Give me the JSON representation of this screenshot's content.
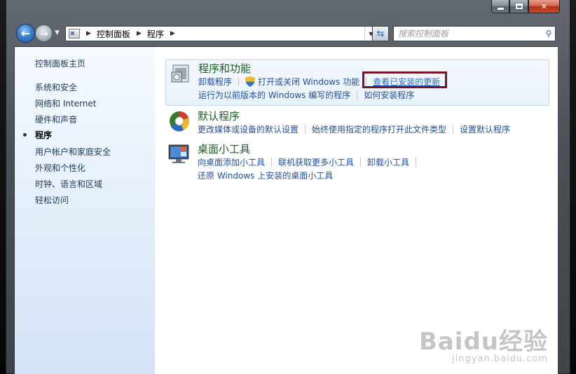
{
  "window": {
    "caption_buttons": {
      "minimize": "minimize",
      "maximize": "maximize",
      "close": "✕"
    }
  },
  "toolbar": {
    "breadcrumb": [
      "控制面板",
      "程序"
    ],
    "search_placeholder": "搜索控制面板"
  },
  "sidebar": {
    "items": [
      {
        "label": "控制面板主页",
        "active": false
      },
      {
        "label": "系统和安全",
        "active": false
      },
      {
        "label": "网络和 Internet",
        "active": false
      },
      {
        "label": "硬件和声音",
        "active": false
      },
      {
        "label": "程序",
        "active": true
      },
      {
        "label": "用户帐户和家庭安全",
        "active": false
      },
      {
        "label": "外观和个性化",
        "active": false
      },
      {
        "label": "时钟、语言和区域",
        "active": false
      },
      {
        "label": "轻松访问",
        "active": false
      }
    ]
  },
  "categories": [
    {
      "title": "程序和功能",
      "icon": "programs-features-icon",
      "rows": [
        [
          "卸载程序",
          "打开或关闭 Windows 功能",
          "查看已安装的更新"
        ],
        [
          "运行为以前版本的 Windows 编写的程序",
          "如何安装程序"
        ]
      ]
    },
    {
      "title": "默认程序",
      "icon": "default-programs-icon",
      "rows": [
        [
          "更改媒体或设备的默认设置",
          "始终使用指定的程序打开此文件类型",
          "设置默认程序"
        ]
      ]
    },
    {
      "title": "桌面小工具",
      "icon": "desktop-gadgets-icon",
      "rows": [
        [
          "向桌面添加小工具",
          "联机获取更多小工具",
          "卸载小工具"
        ],
        [
          "还原 Windows 上安装的桌面小工具"
        ]
      ]
    }
  ],
  "watermark": {
    "main": "Baidu经验",
    "sub": "jingyan.baidu.com"
  },
  "colors": {
    "highlight_box": "#7a1424",
    "link": "#1f4e9f",
    "category_title": "#1e5f24"
  }
}
